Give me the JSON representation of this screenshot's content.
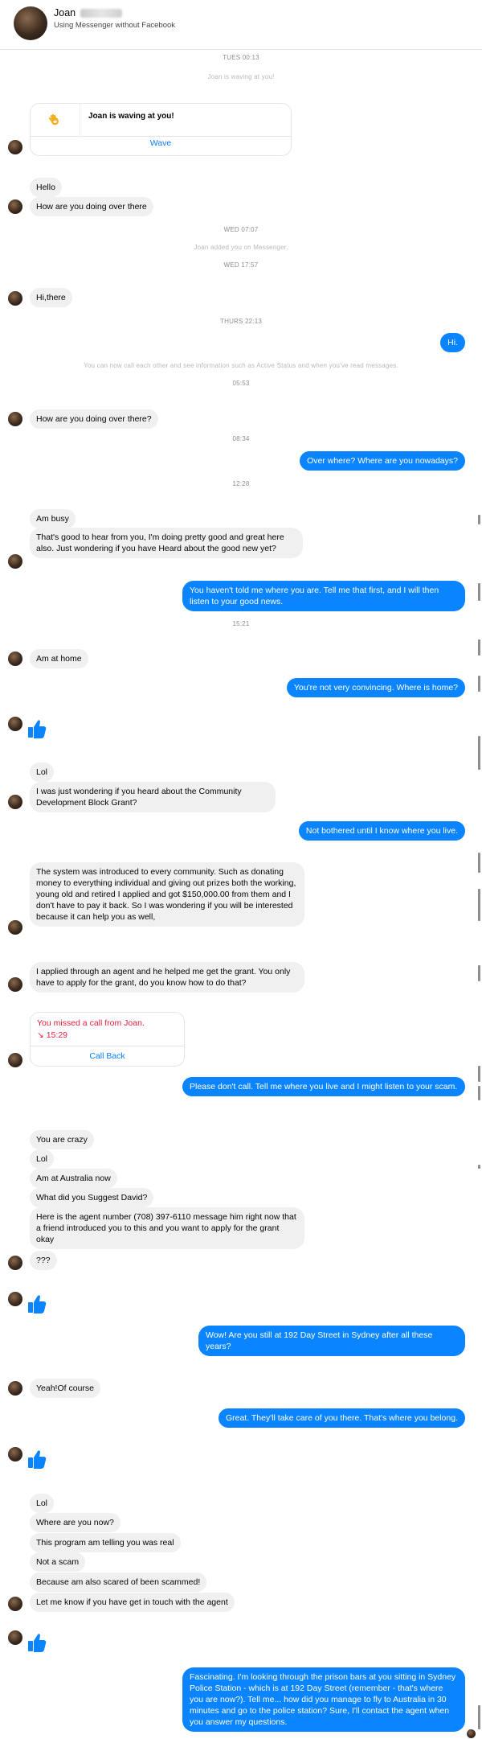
{
  "header": {
    "contact_name": "Joan",
    "subtitle": "Using Messenger without Facebook"
  },
  "timestamps": {
    "t1": "TUES 00:13",
    "t1_note": "Joan is waving at you!",
    "t2": "WED 07:07",
    "t2_note": "Joan added you on Messenger.",
    "t3": "WED 17:57",
    "t4": "THURS 22:13",
    "t4_note": "You can now call each other and see information such as Active Status and when you've read messages.",
    "t5": "05:53",
    "t6": "08:34",
    "t7": "12:28",
    "t8": "15:21"
  },
  "wave_card": {
    "title": "Joan is waving at you!",
    "button": "Wave",
    "icon": "waving-hand-icon"
  },
  "missed_call": {
    "title": "You missed a call from Joan.",
    "time": "15:29",
    "button": "Call Back"
  },
  "messages": {
    "m1": "Hello",
    "m2": "How are you doing over there",
    "m3": "Hi,there",
    "m4": "Hi.",
    "m5": "How are you doing over there?",
    "m6": "Over where? Where are you nowadays?",
    "m7": "Am busy",
    "m8": "That's good to hear from you, I'm doing pretty good and great here also. Just wondering if you have Heard about the good new yet?",
    "m9": "You haven't told me where you are. Tell me that first, and I will then listen to your good news.",
    "m10": "Am at home",
    "m11": "You're not very convincing. Where is home?",
    "m12": "Lol",
    "m13": "I was just wondering if you heard about the Community Development Block Grant?",
    "m14": "Not bothered until I know where you live.",
    "m15": "The system was introduced to  every community. Such as donating money to everything individual and giving out prizes both the working, young old and retired  I applied and got $150,000.00 from them and I don't have to pay it back. So I was wondering if you will be interested because it can help you as well,",
    "m16": "I applied through an agent and he helped me get the grant. You only have to apply for the grant, do you know how to do that?",
    "m17": "Please don't call. Tell me where you live and I might listen to your scam.",
    "m18": "You are crazy",
    "m19": "Lol",
    "m20": "Am at Australia now",
    "m21": "What did you Suggest David?",
    "m22": "Here is the agent number (708) 397-6110 message him right now that a friend introduced you to this and you want to apply for the grant okay",
    "m23": "???",
    "m24": "Wow!  Are you still at 192 Day Street in Sydney after all these years?",
    "m25": "Yeah!Of course",
    "m26": "Great. They'll take care of you there. That's where you belong.",
    "m27": "Lol",
    "m28": "Where are you now?",
    "m29": "This program am telling you was real",
    "m30": "Not a scam",
    "m31": "Because am also scared of been scammed!",
    "m32": "Let me know if you have get in touch with the agent",
    "m33": "Fascinating. I'm looking through the prison bars at you sitting in Sydney Police Station - which is at 192 Day Street (remember - that's where you are now?). Tell me... how did you manage to fly to Australia in 30 minutes and go to the police station? Sure, I'll contact the agent when you answer my questions."
  },
  "colors": {
    "outgoing_bubble": "#0a84ff",
    "incoming_bubble": "#f0f0f0",
    "like_thumb": "#0a84ff",
    "missed_call_text": "#e41e3f"
  }
}
